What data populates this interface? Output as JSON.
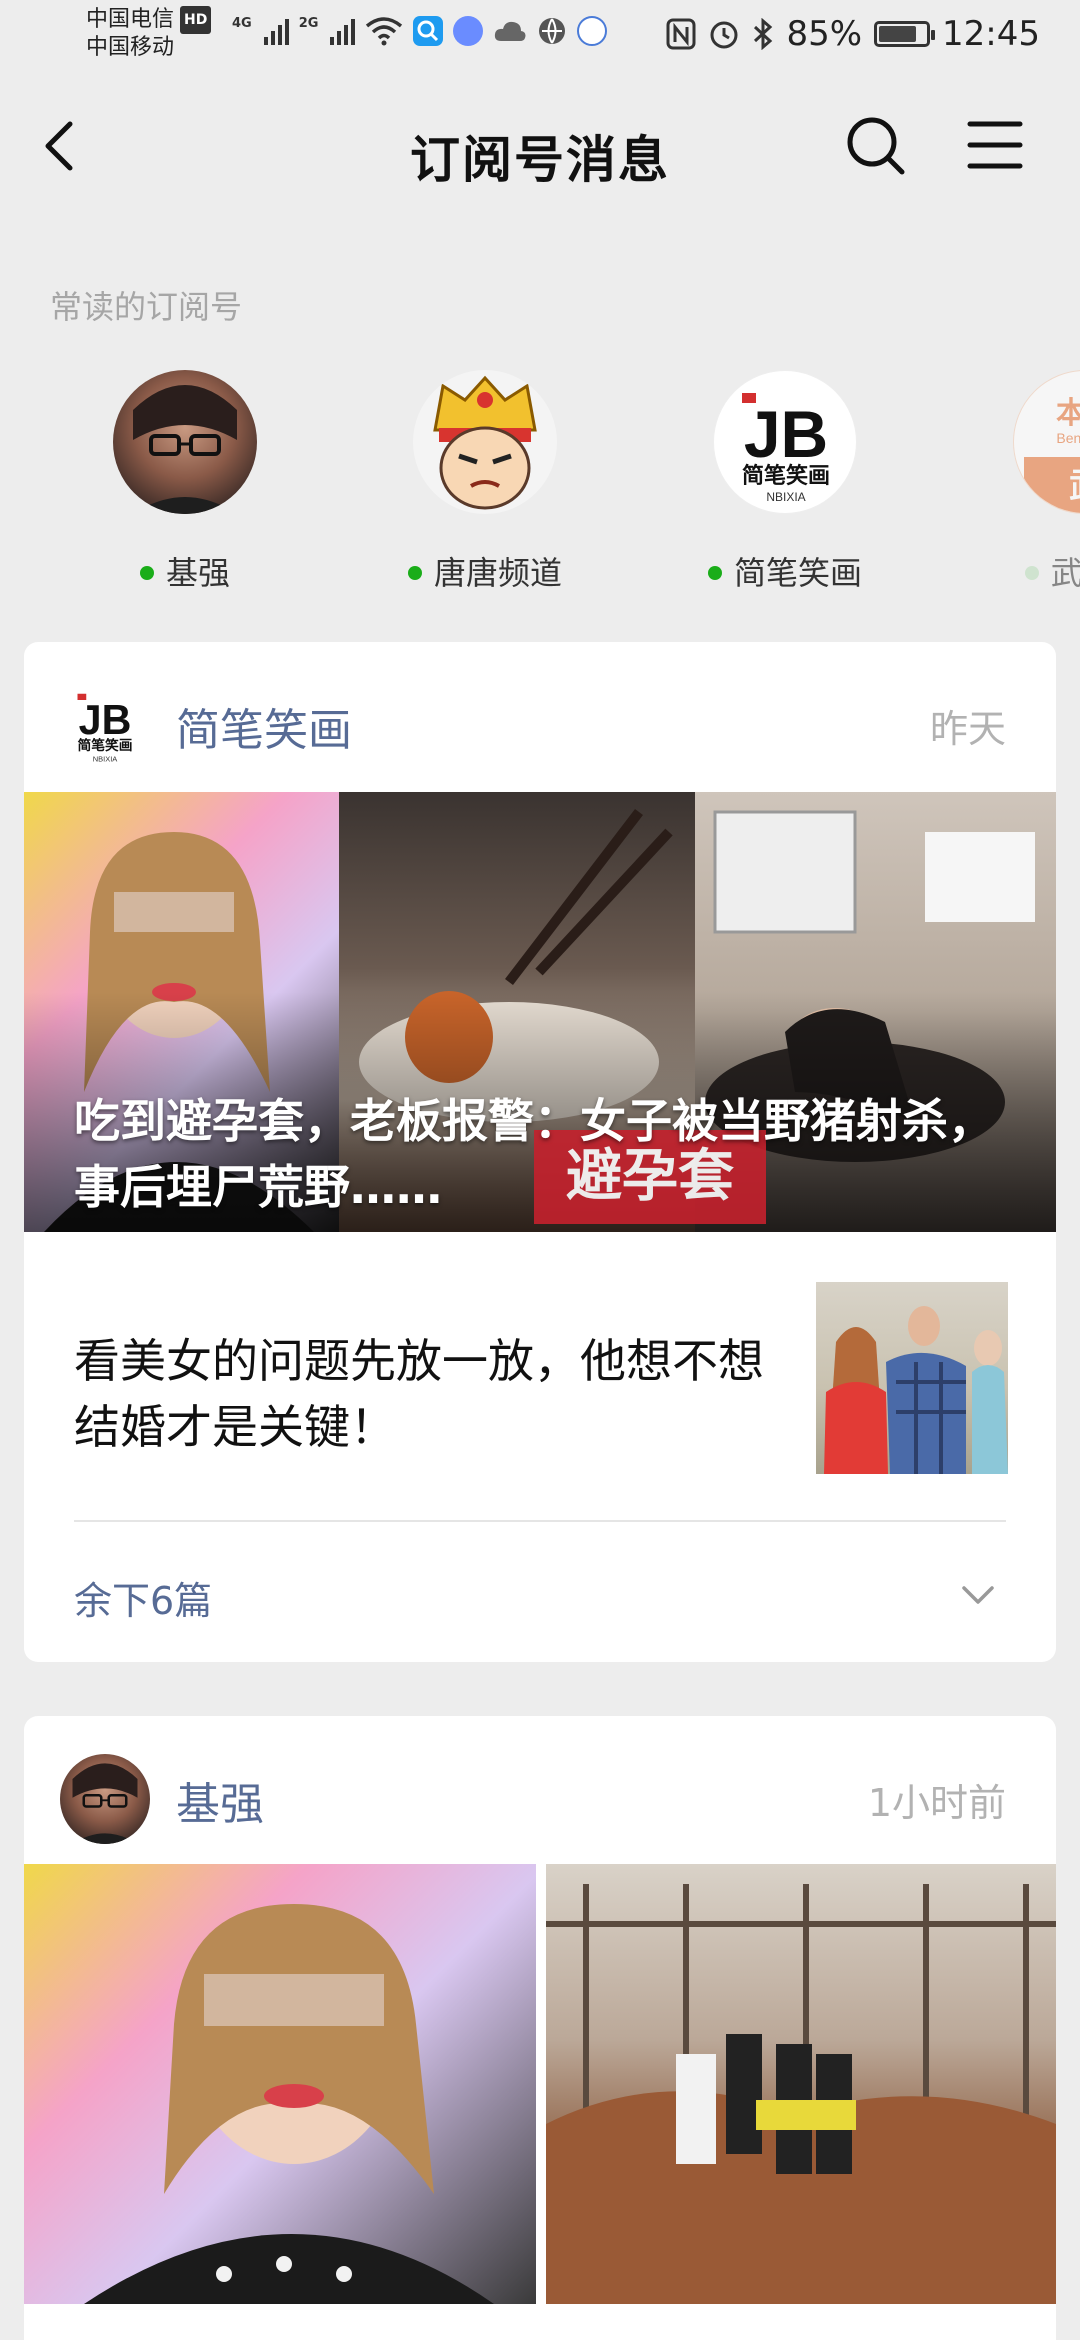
{
  "status_bar": {
    "carrier1": "中国电信",
    "hd_badge": "HD",
    "carrier2": "中国移动",
    "net1": "4G",
    "net2": "2G",
    "battery_pct": "85%",
    "battery_level": 0.85,
    "time": "12:45",
    "icons": [
      "signal-icon",
      "wifi-icon",
      "search-app-icon",
      "music-app-icon",
      "cloud-icon",
      "browser-icon",
      "ifly-icon",
      "nfc-icon",
      "alarm-icon",
      "bluetooth-icon",
      "battery-icon"
    ]
  },
  "nav": {
    "title": "订阅号消息",
    "icons": [
      "back-icon",
      "search-icon",
      "menu-icon"
    ]
  },
  "frequent": {
    "label": "常读的订阅号",
    "items": [
      {
        "name": "基强"
      },
      {
        "name": "唐唐频道"
      },
      {
        "name": "简笔笑画"
      },
      {
        "name": "武汉..."
      }
    ],
    "dot_color": "#1aad19"
  },
  "card1": {
    "account": "简笔笑画",
    "time": "昨天",
    "hero_title": "吃到避孕套，老板报警：女子被当野猪射杀，事后埋尸荒野……",
    "hero_tag": "避孕套",
    "sub_title": "看美女的问题先放一放，他想不想结婚才是关键！",
    "more": "余下6篇"
  },
  "card2": {
    "account": "基强",
    "time": "1小时前"
  },
  "logo": {
    "jb_text": "JB",
    "jb_sub": "简笔笑画",
    "jb_small": "NBIXIA",
    "bendi": "本地",
    "bendi_small": "Bendibao",
    "wu": "武"
  },
  "colors": {
    "link": "#576b95",
    "muted": "#b2b2b2",
    "background": "#ededed",
    "accent_red": "#c5212d"
  }
}
